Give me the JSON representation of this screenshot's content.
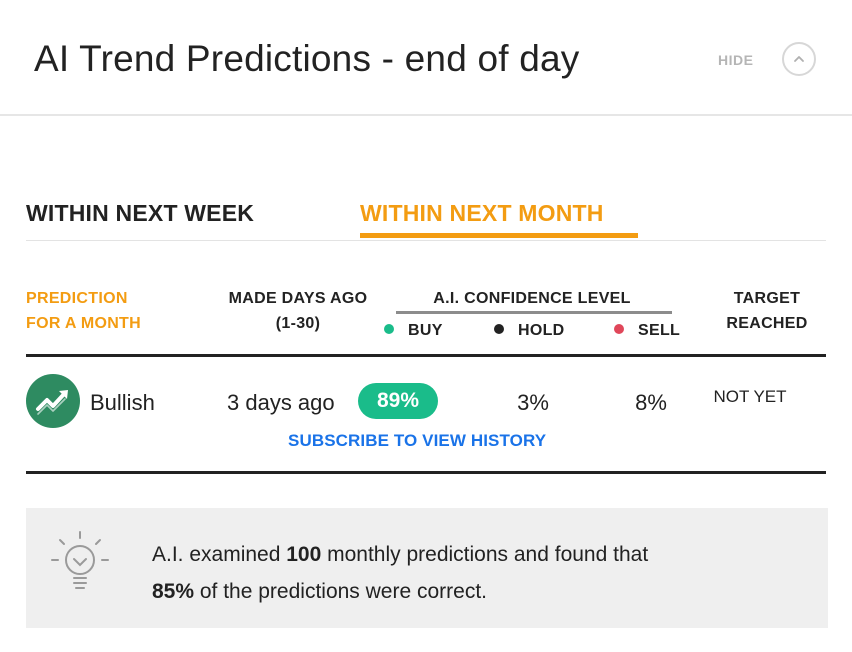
{
  "header": {
    "title": "AI Trend Predictions - end of day",
    "hide_label": "HIDE",
    "collapse_icon": "chevron-up-icon"
  },
  "tabs": [
    {
      "label": "WITHIN NEXT WEEK",
      "active": false
    },
    {
      "label": "WITHIN NEXT MONTH",
      "active": true
    }
  ],
  "table": {
    "headers": {
      "prediction_line1": "PREDICTION",
      "prediction_line2": "FOR A MONTH",
      "made_line1": "MADE DAYS AGO",
      "made_line2": "(1-30)",
      "confidence": "A.I. CONFIDENCE LEVEL",
      "target_line1": "TARGET",
      "target_line2": "REACHED"
    },
    "legend": [
      {
        "label": "BUY",
        "color": "#1abc8a"
      },
      {
        "label": "HOLD",
        "color": "#222222"
      },
      {
        "label": "SELL",
        "color": "#e0475a"
      }
    ],
    "row": {
      "prediction": "Bullish",
      "prediction_icon": "trend-up-icon",
      "made": "3 days ago",
      "buy": "89%",
      "hold": "3%",
      "sell": "8%",
      "target": "NOT YET"
    },
    "subscribe_link": "SUBSCRIBE TO VIEW HISTORY"
  },
  "insight": {
    "icon": "lightbulb-icon",
    "text_a": "A.I. examined ",
    "count": "100",
    "text_b": " monthly predictions and found that",
    "percent": "85%",
    "text_c": " of the predictions were correct."
  },
  "colors": {
    "accent": "#f39c12",
    "buy": "#1abc8a",
    "link": "#1a73e8",
    "bullish_icon": "#2e8b61"
  }
}
